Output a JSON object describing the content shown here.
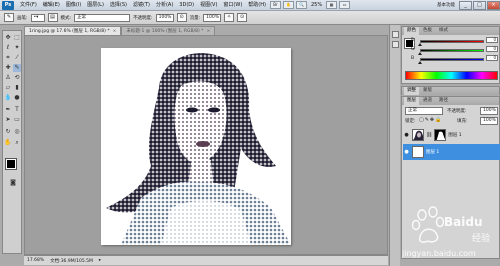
{
  "app": {
    "logo": "Ps"
  },
  "menubar": {
    "items": [
      "文件(F)",
      "编辑(E)",
      "图像(I)",
      "图层(L)",
      "选择(S)",
      "滤镜(T)",
      "分析(A)",
      "3D(D)",
      "视图(V)",
      "窗口(W)",
      "帮助(H)"
    ],
    "zoom": "25%",
    "workspace": "基本功能",
    "window_buttons": [
      "_",
      "□",
      "×"
    ]
  },
  "options_bar": {
    "brush_label": "画笔:",
    "mode_label": "模式:",
    "mode_value": "正常",
    "opacity_label": "不透明度:",
    "opacity_value": "100%",
    "flow_label": "流量:",
    "flow_value": "100%"
  },
  "tabs": [
    {
      "label": "1ring.jpg @ 17.6% (图层 1, RGB/8) *",
      "active": true
    },
    {
      "label": "未标题-1 @ 100% (图层 1, RGB/8) *",
      "active": false
    }
  ],
  "status": {
    "zoom": "17.68%",
    "doc_info": "文档:36.9M/105.5M"
  },
  "color_panel": {
    "tabs": [
      "颜色",
      "色板",
      "样式"
    ],
    "sliders": [
      {
        "label": "R",
        "value": "0",
        "level": 0,
        "color": "#ff0000"
      },
      {
        "label": "G",
        "value": "0",
        "level": 0,
        "color": "#00ff00"
      },
      {
        "label": "B",
        "value": "0",
        "level": 0,
        "color": "#0000ff"
      }
    ]
  },
  "adjust_panel": {
    "tabs": [
      "调整",
      "蒙版"
    ]
  },
  "layers_panel": {
    "tabs": [
      "图层",
      "通道",
      "路径"
    ],
    "blend_mode": "正常",
    "opacity_label": "不透明度:",
    "opacity_value": "100%",
    "lock_label": "锁定:",
    "fill_label": "填充:",
    "fill_value": "100%",
    "layers": [
      {
        "name": "图层 1",
        "selected": false
      },
      {
        "name": "图层 1",
        "selected": true
      }
    ]
  },
  "watermark": {
    "brand": "Baidu",
    "cn": "经验",
    "url": "jingyan.baidu.com"
  }
}
